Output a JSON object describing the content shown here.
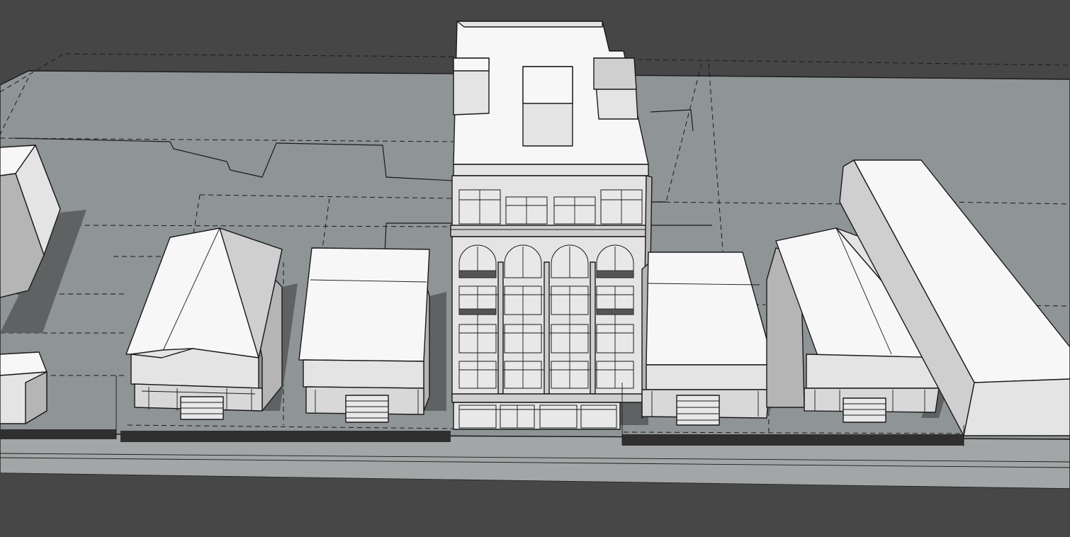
{
  "scene": {
    "type": "3d-massing-model",
    "view": "aerial-perspective",
    "colors": {
      "background": "#454545",
      "ground": "#8f9496",
      "sidewalk": "#a3a6a7",
      "street": "#474747",
      "building_light": "#f7f7f7",
      "building_wall": "#e4e4e4",
      "shadow": "#5f6263",
      "edge": "#1a1a1a"
    },
    "objects": [
      "street-back",
      "ground-plane",
      "sidewalk",
      "street-front",
      "parcel-lines",
      "far-left-building",
      "small-left-building",
      "gable-house-left",
      "flat-house-left",
      "main-mixed-use-building",
      "flat-house-right",
      "gable-house-right",
      "long-right-building"
    ]
  }
}
